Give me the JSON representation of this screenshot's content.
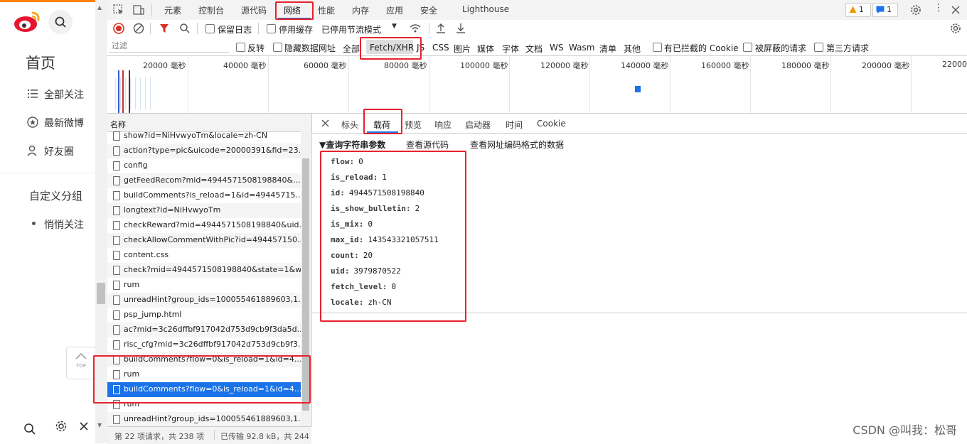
{
  "weibo": {
    "menu": [
      {
        "label": "首页"
      },
      {
        "label": "全部关注"
      },
      {
        "label": "最新微博"
      },
      {
        "label": "好友圈"
      },
      {
        "label": "自定义分组"
      },
      {
        "label": "悄悄关注"
      }
    ],
    "top_button": "TOP"
  },
  "devtools": {
    "panels": [
      "元素",
      "控制台",
      "源代码",
      "网络",
      "性能",
      "内存",
      "应用",
      "安全",
      "Lighthouse"
    ],
    "warning_count": "1",
    "message_count": "1",
    "controls": {
      "preserve_log": "保留日志",
      "disable_cache": "停用缓存",
      "throttling": "已停用节流模式"
    },
    "filter": {
      "placeholder": "过滤",
      "invert": "反转",
      "hide_data_urls": "隐藏数据网址",
      "types": [
        "全部",
        "Fetch/XHR",
        "JS",
        "CSS",
        "图片",
        "媒体",
        "字体",
        "文档",
        "WS",
        "Wasm",
        "清单",
        "其他"
      ],
      "blocked_cookies": "有已拦截的 Cookie",
      "blocked_requests": "被屏蔽的请求",
      "third_party": "第三方请求"
    },
    "timeline_labels": [
      "20000 毫秒",
      "40000 毫秒",
      "60000 毫秒",
      "80000 毫秒",
      "100000 毫秒",
      "120000 毫秒",
      "140000 毫秒",
      "160000 毫秒",
      "180000 毫秒",
      "200000 毫秒",
      "22000"
    ],
    "request_list": {
      "header": "名称",
      "rows": [
        "show?id=NiHvwyoTm&locale=zh-CN",
        "action?type=pic&uicode=20000391&fid=23...",
        "config",
        "getFeedRecom?mid=4944571508198840&...",
        "buildComments?is_reload=1&id=49445715...",
        "longtext?id=NiHvwyoTm",
        "checkReward?mid=4944571508198840&uid...",
        "checkAllowCommentWithPic?id=494457150...",
        "content.css",
        "check?mid=4944571508198840&state=1&w...",
        "rum",
        "unreadHint?group_ids=100055461889603,1...",
        "psp_jump.html",
        "ac?mid=3c26dffbf917042d753d9cb9f3da5d...",
        "risc_cfg?mid=3c26dffbf917042d753d9cb9f3...",
        "buildComments?flow=0&is_reload=1&id=4...",
        "rum",
        "buildComments?flow=0&is_reload=1&id=4...",
        "rum",
        "unreadHint?group_ids=100055461889603,1..."
      ],
      "selected_index": 17
    },
    "status": {
      "requests": "第 22 项请求，共 238 项",
      "transferred": "已传输 92.8 kB，共 244"
    },
    "detail_tabs": [
      "标头",
      "载荷",
      "预览",
      "响应",
      "启动器",
      "时间",
      "Cookie"
    ],
    "active_detail_tab": "载荷",
    "payload": {
      "section_title": "▼查询字符串参数",
      "view_source": "查看源代码",
      "view_url_encoded": "查看网址编码格式的数据",
      "params": [
        {
          "key": "flow:",
          "value": "0"
        },
        {
          "key": "is_reload:",
          "value": "1"
        },
        {
          "key": "id:",
          "value": "4944571508198840"
        },
        {
          "key": "is_show_bulletin:",
          "value": "2"
        },
        {
          "key": "is_mix:",
          "value": "0"
        },
        {
          "key": "max_id:",
          "value": "143543321057511"
        },
        {
          "key": "count:",
          "value": "20"
        },
        {
          "key": "uid:",
          "value": "3979870522"
        },
        {
          "key": "fetch_level:",
          "value": "0"
        },
        {
          "key": "locale:",
          "value": "zh-CN"
        }
      ]
    }
  },
  "watermark": "CSDN @叫我：松哥",
  "colors": {
    "highlight_red": "#e8222b",
    "select_blue": "#1a73e8",
    "weibo_red": "#e6162d"
  }
}
